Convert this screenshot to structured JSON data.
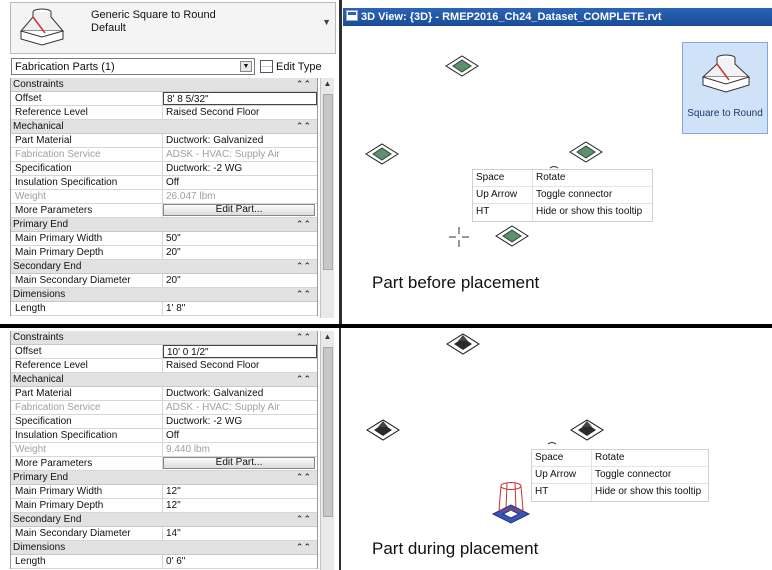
{
  "type_selector": {
    "family": "Generic Square to Round",
    "type": "Default"
  },
  "properties_top": {
    "filter": "Fabrication Parts (1)",
    "edit_type": "Edit Type",
    "constraints": {
      "title": "Constraints",
      "offset_label": "Offset",
      "offset_value": "8'  8 5/32\"",
      "ref_label": "Reference Level",
      "ref_value": "Raised Second Floor"
    },
    "mechanical": {
      "title": "Mechanical",
      "part_material_label": "Part Material",
      "part_material_value": "Ductwork: Galvanized",
      "service_label": "Fabrication Service",
      "service_value": "ADSK - HVAC: Supply Air",
      "spec_label": "Specification",
      "spec_value": "Ductwork: -2 WG",
      "insul_label": "Insulation Specification",
      "insul_value": "Off",
      "weight_label": "Weight",
      "weight_value": "26.047 lbm",
      "more_label": "More Parameters",
      "edit_part": "Edit Part..."
    },
    "primary_end": {
      "title": "Primary End",
      "width_label": "Main Primary Width",
      "width_value": "50\"",
      "depth_label": "Main Primary Depth",
      "depth_value": "20\""
    },
    "secondary_end": {
      "title": "Secondary End",
      "diam_label": "Main Secondary Diameter",
      "diam_value": "20\""
    },
    "dimensions": {
      "title": "Dimensions",
      "length_label": "Length",
      "length_value": "1'  8\""
    }
  },
  "properties_bottom": {
    "constraints": {
      "title": "Constraints",
      "offset_label": "Offset",
      "offset_value": "10'  0 1/2\"",
      "ref_label": "Reference Level",
      "ref_value": "Raised Second Floor"
    },
    "mechanical": {
      "title": "Mechanical",
      "part_material_label": "Part Material",
      "part_material_value": "Ductwork: Galvanized",
      "service_label": "Fabrication Service",
      "service_value": "ADSK - HVAC: Supply Air",
      "spec_label": "Specification",
      "spec_value": "Ductwork: -2 WG",
      "insul_label": "Insulation Specification",
      "insul_value": "Off",
      "weight_label": "Weight",
      "weight_value": "9.440 lbm",
      "more_label": "More Parameters",
      "edit_part": "Edit Part..."
    },
    "primary_end": {
      "title": "Primary End",
      "width_label": "Main Primary Width",
      "width_value": "12\"",
      "depth_label": "Main Primary Depth",
      "depth_value": "12\""
    },
    "secondary_end": {
      "title": "Secondary End",
      "diam_label": "Main Secondary Diameter",
      "diam_value": "14\""
    },
    "dimensions": {
      "title": "Dimensions",
      "length_label": "Length",
      "length_value": "0'  6\""
    }
  },
  "view": {
    "title": "3D View: {3D} - RMEP2016_Ch24_Dataset_COMPLETE.rvt"
  },
  "palette": {
    "label": "Square to Round"
  },
  "tooltip_top": {
    "rows": [
      {
        "key": "Space",
        "desc": "Rotate"
      },
      {
        "key": "Up Arrow",
        "desc": "Toggle connector"
      },
      {
        "key": "HT",
        "desc": "Hide or show this tooltip"
      }
    ]
  },
  "tooltip_bottom": {
    "rows": [
      {
        "key": "Space",
        "desc": "Rotate"
      },
      {
        "key": "Up Arrow",
        "desc": "Toggle connector"
      },
      {
        "key": "HT",
        "desc": "Hide or show this tooltip"
      }
    ]
  },
  "captions": {
    "top": "Part before placement",
    "bottom": "Part during placement"
  },
  "colors": {
    "title_bar": "#1f56a8",
    "fitting_green": "#5f8f6f",
    "fitting_dark": "#2b2b2b",
    "palette_bg": "#cfe2f8"
  },
  "icons": {
    "fitting": "square-to-round-fitting-icon",
    "cursor": "crosshair-cursor-icon",
    "view": "revit-3d-view-icon"
  }
}
